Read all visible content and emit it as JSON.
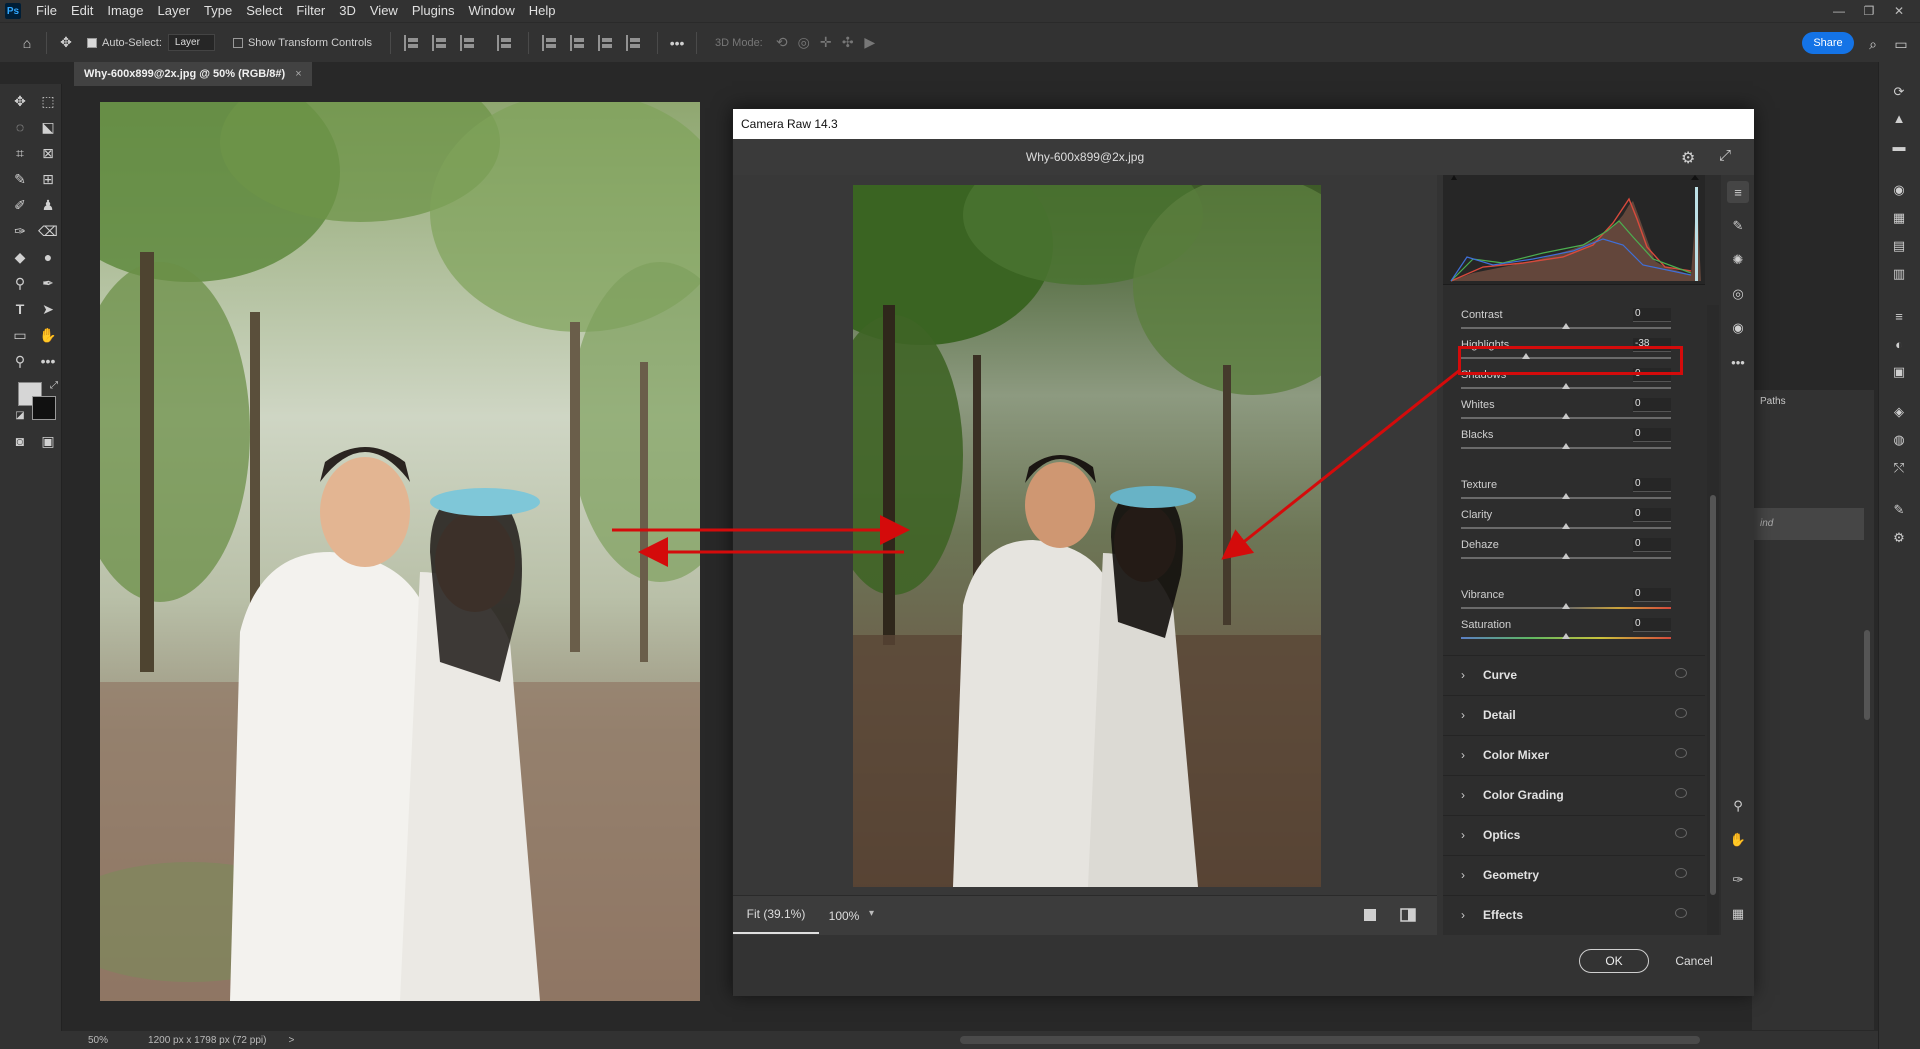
{
  "menubar": {
    "logo": "Ps",
    "items": [
      "File",
      "Edit",
      "Image",
      "Layer",
      "Type",
      "Select",
      "Filter",
      "3D",
      "View",
      "Plugins",
      "Window",
      "Help"
    ]
  },
  "options": {
    "auto_select_label": "Auto-Select:",
    "auto_select_value": "Layer",
    "show_transform_label": "Show Transform Controls",
    "mode_3d_label": "3D Mode:",
    "share_label": "Share"
  },
  "document": {
    "tab_title": "Why-600x899@2x.jpg @ 50% (RGB/8#)",
    "tab_close": "×"
  },
  "status": {
    "zoom": "50%",
    "size": "1200 px x 1798 px (72 ppi)",
    "chevron": ">"
  },
  "paths_panel": {
    "tab": "Paths",
    "row_label": "ind"
  },
  "camera_raw": {
    "title": "Camera Raw 14.3",
    "filename": "Why-600x899@2x.jpg",
    "zoom_fit": "Fit (39.1%)",
    "zoom_100": "100%",
    "ok_label": "OK",
    "cancel_label": "Cancel",
    "sliders": [
      {
        "label": "Contrast",
        "value": "0",
        "pos": 0.5
      },
      {
        "label": "Highlights",
        "value": "-38",
        "pos": 0.31
      },
      {
        "label": "Shadows",
        "value": "0",
        "pos": 0.5
      },
      {
        "label": "Whites",
        "value": "0",
        "pos": 0.5
      },
      {
        "label": "Blacks",
        "value": "0",
        "pos": 0.5
      },
      {
        "label": "Texture",
        "value": "0",
        "pos": 0.5
      },
      {
        "label": "Clarity",
        "value": "0",
        "pos": 0.5
      },
      {
        "label": "Dehaze",
        "value": "0",
        "pos": 0.5
      },
      {
        "label": "Vibrance",
        "value": "0",
        "pos": 0.5
      },
      {
        "label": "Saturation",
        "value": "0",
        "pos": 0.5
      }
    ],
    "sections": [
      "Curve",
      "Detail",
      "Color Mixer",
      "Color Grading",
      "Optics",
      "Geometry",
      "Effects"
    ]
  },
  "colors": {
    "accent": "#1473e6",
    "annotation": "#d40b0b"
  }
}
